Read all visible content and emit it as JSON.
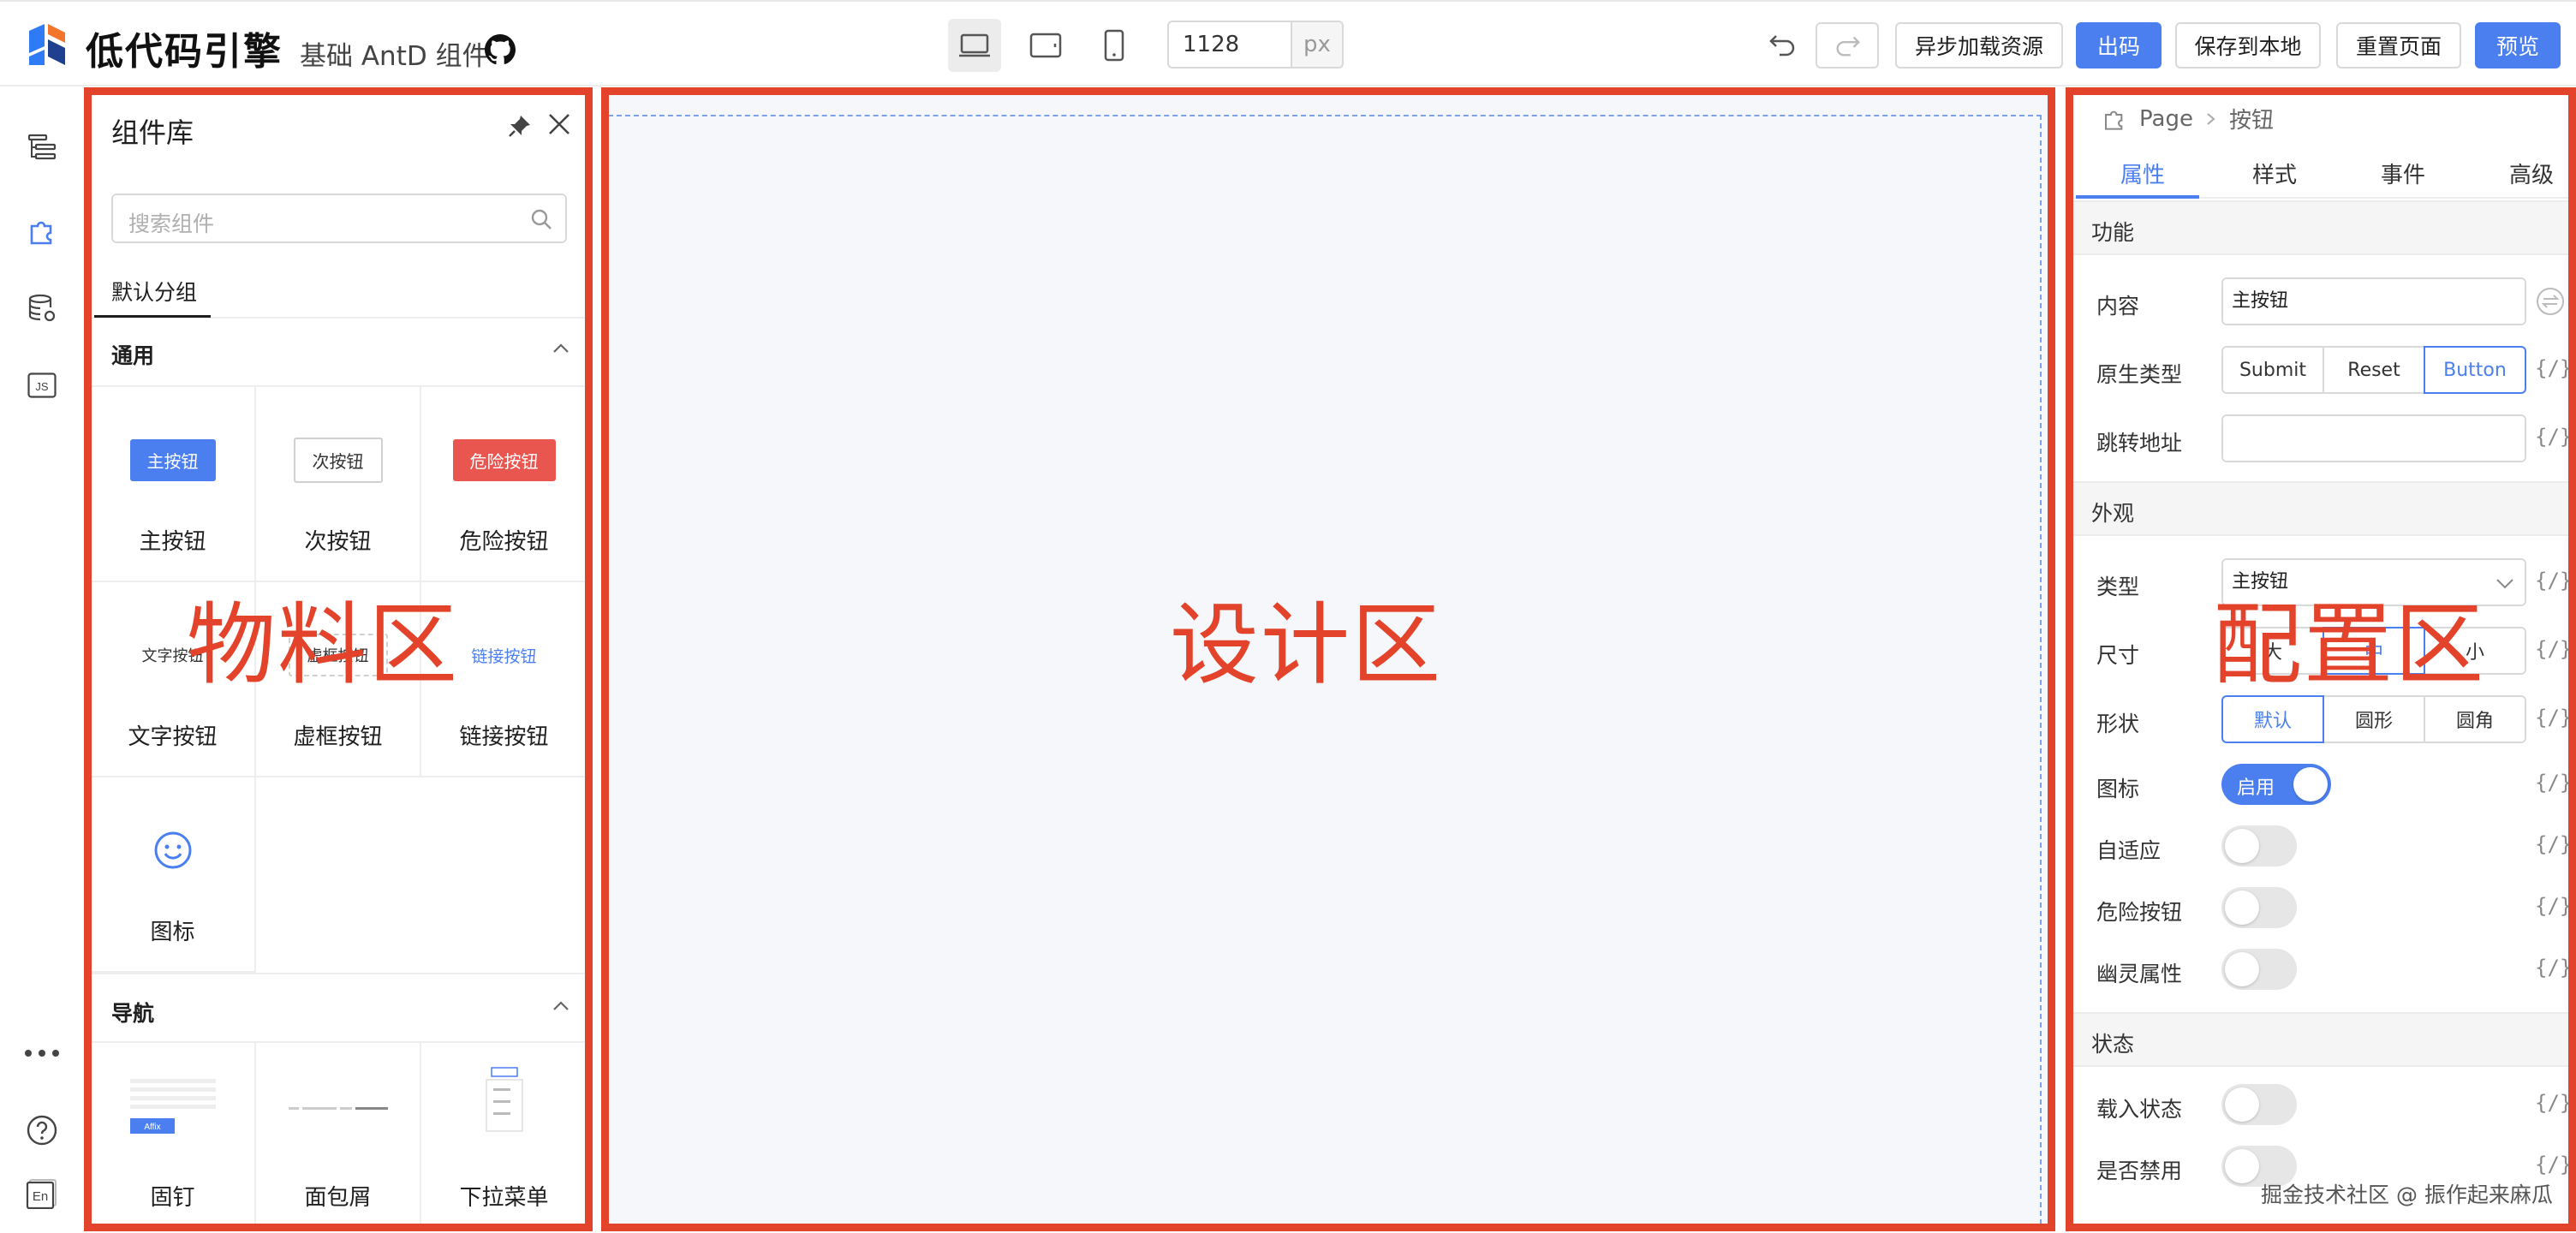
{
  "app": {
    "brand": "低代码引擎",
    "subtitle": "基础 AntD 组件",
    "brand_colors": [
      "#2f7bf5",
      "#f3742b",
      "#1f3f8f"
    ]
  },
  "toolbar": {
    "devices": [
      "desktop-icon",
      "tablet-icon",
      "mobile-icon"
    ],
    "active_device": "desktop",
    "canvas_width": "1128",
    "canvas_width_unit": "px",
    "async_load_label": "异步加载资源",
    "export_label": "出码",
    "save_local_label": "保存到本地",
    "reset_page_label": "重置页面",
    "preview_label": "预览"
  },
  "rail": {
    "icons": [
      "outline-tree-icon",
      "component-puzzle-icon",
      "datasource-icon",
      "js-code-icon",
      "more-icon",
      "help-icon",
      "language-en-icon"
    ],
    "language": "En",
    "js_label": "JS"
  },
  "material": {
    "title": "组件库",
    "search_placeholder": "搜索组件",
    "tab": "默认分组",
    "group_general": "通用",
    "group_nav": "导航",
    "general_items": [
      {
        "name": "主按钮",
        "preview": "主按钮"
      },
      {
        "name": "次按钮",
        "preview": "次按钮"
      },
      {
        "name": "危险按钮",
        "preview": "危险按钮"
      },
      {
        "name": "文字按钮",
        "preview": "文字按钮"
      },
      {
        "name": "虚框按钮",
        "preview": "虚框按钮"
      },
      {
        "name": "链接按钮",
        "preview": "链接按钮"
      },
      {
        "name": "图标",
        "preview": ""
      }
    ],
    "nav_items": [
      {
        "name": "固钉",
        "preview": "Affix"
      },
      {
        "name": "面包屑",
        "preview": ""
      },
      {
        "name": "下拉菜单",
        "preview": ""
      }
    ]
  },
  "labels": {
    "material_region": "物料区",
    "design_region": "设计区",
    "config_region": "配置区"
  },
  "settings": {
    "breadcrumb_root": "Page",
    "breadcrumb_current": "按钮",
    "tabs": [
      "属性",
      "样式",
      "事件",
      "高级"
    ],
    "active_tab": "属性",
    "section_function": "功能",
    "section_appearance": "外观",
    "section_state": "状态",
    "content_label": "内容",
    "content_value": "主按钮",
    "native_type_label": "原生类型",
    "native_type_options": [
      "Submit",
      "Reset",
      "Button"
    ],
    "native_type_selected": "Button",
    "href_label": "跳转地址",
    "href_value": "",
    "type_label": "类型",
    "type_value": "主按钮",
    "size_label": "尺寸",
    "size_options": [
      "大",
      "中",
      "小"
    ],
    "size_selected": "中",
    "shape_label": "形状",
    "shape_options": [
      "默认",
      "圆形",
      "圆角"
    ],
    "shape_selected": "默认",
    "icon_label": "图标",
    "icon_toggle_text": "启用",
    "icon_enabled": true,
    "block_label": "自适应",
    "block_enabled": false,
    "danger_label": "危险按钮",
    "danger_enabled": false,
    "ghost_label": "幽灵属性",
    "ghost_enabled": false,
    "loading_label": "载入状态",
    "loading_enabled": false,
    "disabled_label": "是否禁用",
    "disabled_enabled": false,
    "variable_glyph": "{/}"
  },
  "watermark": "掘金技术社区 @ 振作起来麻瓜",
  "colors": {
    "accent": "#4b7ff0",
    "annotation_red": "#e4432b",
    "danger": "#e9554f"
  }
}
